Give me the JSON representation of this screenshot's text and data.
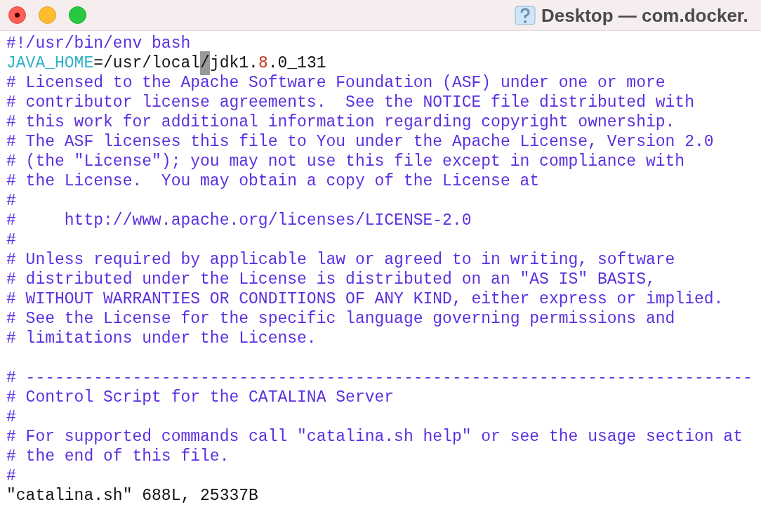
{
  "window": {
    "title": "Desktop — com.docker."
  },
  "lines": [
    {
      "kind": "code",
      "segments": [
        {
          "kind": "comment",
          "text": "#!/usr/bin/env bash"
        }
      ]
    },
    {
      "kind": "code",
      "segments": [
        {
          "kind": "variable",
          "text": "JAVA_HOME"
        },
        {
          "kind": "plain",
          "text": "=/usr/local"
        },
        {
          "kind": "cursor",
          "text": "/"
        },
        {
          "kind": "plain",
          "text": "jdk1."
        },
        {
          "kind": "number",
          "text": "8"
        },
        {
          "kind": "plain",
          "text": ".0_131"
        }
      ]
    },
    {
      "kind": "code",
      "segments": [
        {
          "kind": "comment",
          "text": "# Licensed to the Apache Software Foundation (ASF) under one or more"
        }
      ]
    },
    {
      "kind": "code",
      "segments": [
        {
          "kind": "comment",
          "text": "# contributor license agreements.  See the NOTICE file distributed with"
        }
      ]
    },
    {
      "kind": "code",
      "segments": [
        {
          "kind": "comment",
          "text": "# this work for additional information regarding copyright ownership."
        }
      ]
    },
    {
      "kind": "code",
      "segments": [
        {
          "kind": "comment",
          "text": "# The ASF licenses this file to You under the Apache License, Version 2.0"
        }
      ]
    },
    {
      "kind": "code",
      "segments": [
        {
          "kind": "comment",
          "text": "# (the \"License\"); you may not use this file except in compliance with"
        }
      ]
    },
    {
      "kind": "code",
      "segments": [
        {
          "kind": "comment",
          "text": "# the License.  You may obtain a copy of the License at"
        }
      ]
    },
    {
      "kind": "code",
      "segments": [
        {
          "kind": "comment",
          "text": "#"
        }
      ]
    },
    {
      "kind": "code",
      "segments": [
        {
          "kind": "comment",
          "text": "#     http://www.apache.org/licenses/LICENSE-2.0"
        }
      ]
    },
    {
      "kind": "code",
      "segments": [
        {
          "kind": "comment",
          "text": "#"
        }
      ]
    },
    {
      "kind": "code",
      "segments": [
        {
          "kind": "comment",
          "text": "# Unless required by applicable law or agreed to in writing, software"
        }
      ]
    },
    {
      "kind": "code",
      "segments": [
        {
          "kind": "comment",
          "text": "# distributed under the License is distributed on an \"AS IS\" BASIS,"
        }
      ]
    },
    {
      "kind": "code",
      "segments": [
        {
          "kind": "comment",
          "text": "# WITHOUT WARRANTIES OR CONDITIONS OF ANY KIND, either express or implied."
        }
      ]
    },
    {
      "kind": "code",
      "segments": [
        {
          "kind": "comment",
          "text": "# See the License for the specific language governing permissions and"
        }
      ]
    },
    {
      "kind": "code",
      "segments": [
        {
          "kind": "comment",
          "text": "# limitations under the License."
        }
      ]
    },
    {
      "kind": "blank"
    },
    {
      "kind": "code",
      "segments": [
        {
          "kind": "comment",
          "text": "# ---------------------------------------------------------------------------"
        }
      ]
    },
    {
      "kind": "code",
      "segments": [
        {
          "kind": "comment",
          "text": "# Control Script for the CATALINA Server"
        }
      ]
    },
    {
      "kind": "code",
      "segments": [
        {
          "kind": "comment",
          "text": "#"
        }
      ]
    },
    {
      "kind": "code",
      "segments": [
        {
          "kind": "comment",
          "text": "# For supported commands call \"catalina.sh help\" or see the usage section at"
        }
      ]
    },
    {
      "kind": "code",
      "segments": [
        {
          "kind": "comment",
          "text": "# the end of this file."
        }
      ]
    },
    {
      "kind": "code",
      "segments": [
        {
          "kind": "comment",
          "text": "#"
        }
      ]
    }
  ],
  "status_line": "\"catalina.sh\" 688L, 25337B"
}
